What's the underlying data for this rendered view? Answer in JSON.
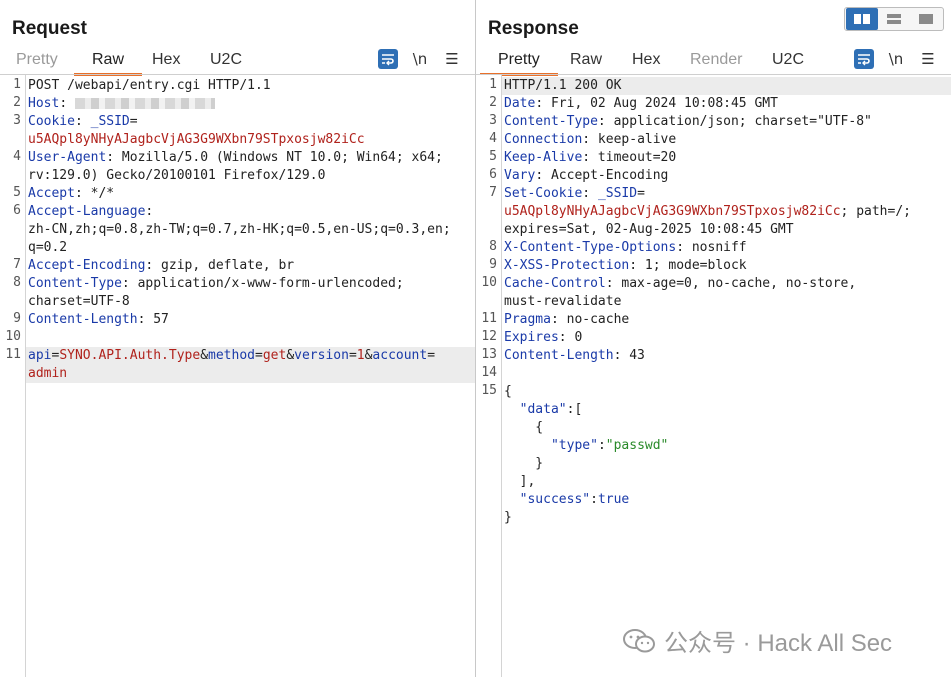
{
  "request": {
    "title": "Request",
    "tabs": [
      "Pretty",
      "Raw",
      "Hex",
      "U2C"
    ],
    "active_tab": "Raw",
    "tools": [
      "wrap",
      "\\n",
      "menu"
    ],
    "lines": [
      {
        "n": "1",
        "parts": [
          {
            "t": "POST /webapi/entry.cgi HTTP/1.1",
            "c": ""
          }
        ]
      },
      {
        "n": "2",
        "parts": [
          {
            "t": "Host",
            "c": "k"
          },
          {
            "t": ": ",
            "c": ""
          },
          {
            "t": "[redacted]",
            "c": "redact"
          }
        ]
      },
      {
        "n": "3",
        "parts": [
          {
            "t": "Cookie",
            "c": "k"
          },
          {
            "t": ": ",
            "c": ""
          },
          {
            "t": "_SSID",
            "c": "k"
          },
          {
            "t": "=",
            "c": ""
          }
        ]
      },
      {
        "n": "",
        "parts": [
          {
            "t": "u5AQpl8yNHyAJagbcVjAG3G9WXbn79STpxosjw82iCc",
            "c": "r"
          }
        ]
      },
      {
        "n": "4",
        "parts": [
          {
            "t": "User-Agent",
            "c": "k"
          },
          {
            "t": ": Mozilla/5.0 (Windows NT 10.0; Win64; x64;",
            "c": ""
          }
        ]
      },
      {
        "n": "",
        "parts": [
          {
            "t": "rv:129.0) Gecko/20100101 Firefox/129.0",
            "c": ""
          }
        ]
      },
      {
        "n": "5",
        "parts": [
          {
            "t": "Accept",
            "c": "k"
          },
          {
            "t": ": */*",
            "c": ""
          }
        ]
      },
      {
        "n": "6",
        "parts": [
          {
            "t": "Accept-Language",
            "c": "k"
          },
          {
            "t": ":",
            "c": ""
          }
        ]
      },
      {
        "n": "",
        "parts": [
          {
            "t": "zh-CN,zh;q=0.8,zh-TW;q=0.7,zh-HK;q=0.5,en-US;q=0.3,en;",
            "c": ""
          }
        ]
      },
      {
        "n": "",
        "parts": [
          {
            "t": "q=0.2",
            "c": ""
          }
        ]
      },
      {
        "n": "7",
        "parts": [
          {
            "t": "Accept-Encoding",
            "c": "k"
          },
          {
            "t": ": gzip, deflate, br",
            "c": ""
          }
        ]
      },
      {
        "n": "8",
        "parts": [
          {
            "t": "Content-Type",
            "c": "k"
          },
          {
            "t": ": application/x-www-form-urlencoded;",
            "c": ""
          }
        ]
      },
      {
        "n": "",
        "parts": [
          {
            "t": "charset=UTF-8",
            "c": ""
          }
        ]
      },
      {
        "n": "9",
        "parts": [
          {
            "t": "Content-Length",
            "c": "k"
          },
          {
            "t": ": 57",
            "c": ""
          }
        ]
      },
      {
        "n": "10",
        "parts": [
          {
            "t": "",
            "c": ""
          }
        ]
      },
      {
        "n": "11",
        "hl": true,
        "parts": [
          {
            "t": "api",
            "c": "k"
          },
          {
            "t": "=",
            "c": ""
          },
          {
            "t": "SYNO.API.Auth.Type",
            "c": "r"
          },
          {
            "t": "&",
            "c": ""
          },
          {
            "t": "method",
            "c": "k"
          },
          {
            "t": "=",
            "c": ""
          },
          {
            "t": "get",
            "c": "r"
          },
          {
            "t": "&",
            "c": ""
          },
          {
            "t": "version",
            "c": "k"
          },
          {
            "t": "=",
            "c": ""
          },
          {
            "t": "1",
            "c": "r"
          },
          {
            "t": "&",
            "c": ""
          },
          {
            "t": "account",
            "c": "k"
          },
          {
            "t": "=",
            "c": ""
          }
        ]
      },
      {
        "n": "",
        "hl": true,
        "parts": [
          {
            "t": "admin",
            "c": "r"
          }
        ]
      }
    ]
  },
  "response": {
    "title": "Response",
    "tabs": [
      "Pretty",
      "Raw",
      "Hex",
      "Render",
      "U2C"
    ],
    "active_tab": "Pretty",
    "tools": [
      "wrap",
      "\\n",
      "menu"
    ],
    "lines": [
      {
        "n": "1",
        "hl": true,
        "parts": [
          {
            "t": "HTTP/1.1 200 OK",
            "c": ""
          }
        ]
      },
      {
        "n": "2",
        "parts": [
          {
            "t": "Date",
            "c": "k"
          },
          {
            "t": ": Fri, 02 Aug 2024 10:08:45 GMT",
            "c": ""
          }
        ]
      },
      {
        "n": "3",
        "parts": [
          {
            "t": "Content-Type",
            "c": "k"
          },
          {
            "t": ": application/json; charset=\"UTF-8\"",
            "c": ""
          }
        ]
      },
      {
        "n": "4",
        "parts": [
          {
            "t": "Connection",
            "c": "k"
          },
          {
            "t": ": keep-alive",
            "c": ""
          }
        ]
      },
      {
        "n": "5",
        "parts": [
          {
            "t": "Keep-Alive",
            "c": "k"
          },
          {
            "t": ": timeout=20",
            "c": ""
          }
        ]
      },
      {
        "n": "6",
        "parts": [
          {
            "t": "Vary",
            "c": "k"
          },
          {
            "t": ": Accept-Encoding",
            "c": ""
          }
        ]
      },
      {
        "n": "7",
        "parts": [
          {
            "t": "Set-Cookie",
            "c": "k"
          },
          {
            "t": ": ",
            "c": ""
          },
          {
            "t": "_SSID",
            "c": "k"
          },
          {
            "t": "=",
            "c": ""
          }
        ]
      },
      {
        "n": "",
        "parts": [
          {
            "t": "u5AQpl8yNHyAJagbcVjAG3G9WXbn79STpxosjw82iCc",
            "c": "r"
          },
          {
            "t": "; path=/;",
            "c": ""
          }
        ]
      },
      {
        "n": "",
        "parts": [
          {
            "t": "expires=Sat, 02-Aug-2025 10:08:45 GMT",
            "c": ""
          }
        ]
      },
      {
        "n": "8",
        "parts": [
          {
            "t": "X-Content-Type-Options",
            "c": "k"
          },
          {
            "t": ": nosniff",
            "c": ""
          }
        ]
      },
      {
        "n": "9",
        "parts": [
          {
            "t": "X-XSS-Protection",
            "c": "k"
          },
          {
            "t": ": 1; mode=block",
            "c": ""
          }
        ]
      },
      {
        "n": "10",
        "parts": [
          {
            "t": "Cache-Control",
            "c": "k"
          },
          {
            "t": ": max-age=0, no-cache, no-store,",
            "c": ""
          }
        ]
      },
      {
        "n": "",
        "parts": [
          {
            "t": "must-revalidate",
            "c": ""
          }
        ]
      },
      {
        "n": "11",
        "parts": [
          {
            "t": "Pragma",
            "c": "k"
          },
          {
            "t": ": no-cache",
            "c": ""
          }
        ]
      },
      {
        "n": "12",
        "parts": [
          {
            "t": "Expires",
            "c": "k"
          },
          {
            "t": ": 0",
            "c": ""
          }
        ]
      },
      {
        "n": "13",
        "parts": [
          {
            "t": "Content-Length",
            "c": "k"
          },
          {
            "t": ": 43",
            "c": ""
          }
        ]
      },
      {
        "n": "14",
        "parts": [
          {
            "t": "",
            "c": ""
          }
        ]
      },
      {
        "n": "15",
        "parts": [
          {
            "t": "{",
            "c": ""
          }
        ]
      },
      {
        "n": "",
        "parts": [
          {
            "t": "  ",
            "c": ""
          },
          {
            "t": "\"data\"",
            "c": "k"
          },
          {
            "t": ":[",
            "c": ""
          }
        ]
      },
      {
        "n": "",
        "parts": [
          {
            "t": "    {",
            "c": ""
          }
        ]
      },
      {
        "n": "",
        "parts": [
          {
            "t": "      ",
            "c": ""
          },
          {
            "t": "\"type\"",
            "c": "k"
          },
          {
            "t": ":",
            "c": ""
          },
          {
            "t": "\"passwd\"",
            "c": "g"
          }
        ]
      },
      {
        "n": "",
        "parts": [
          {
            "t": "    }",
            "c": ""
          }
        ]
      },
      {
        "n": "",
        "parts": [
          {
            "t": "  ],",
            "c": ""
          }
        ]
      },
      {
        "n": "",
        "parts": [
          {
            "t": "  ",
            "c": ""
          },
          {
            "t": "\"success\"",
            "c": "k"
          },
          {
            "t": ":",
            "c": ""
          },
          {
            "t": "true",
            "c": "k"
          }
        ]
      },
      {
        "n": "",
        "parts": [
          {
            "t": "}",
            "c": ""
          }
        ]
      }
    ]
  },
  "watermark": {
    "text": "公众号 · Hack All Sec"
  },
  "colors": {
    "accent": "#e8702a",
    "button": "#2e6fb5",
    "key": "#1a3aa8",
    "value": "#b0221c",
    "string": "#2a8a2a"
  }
}
